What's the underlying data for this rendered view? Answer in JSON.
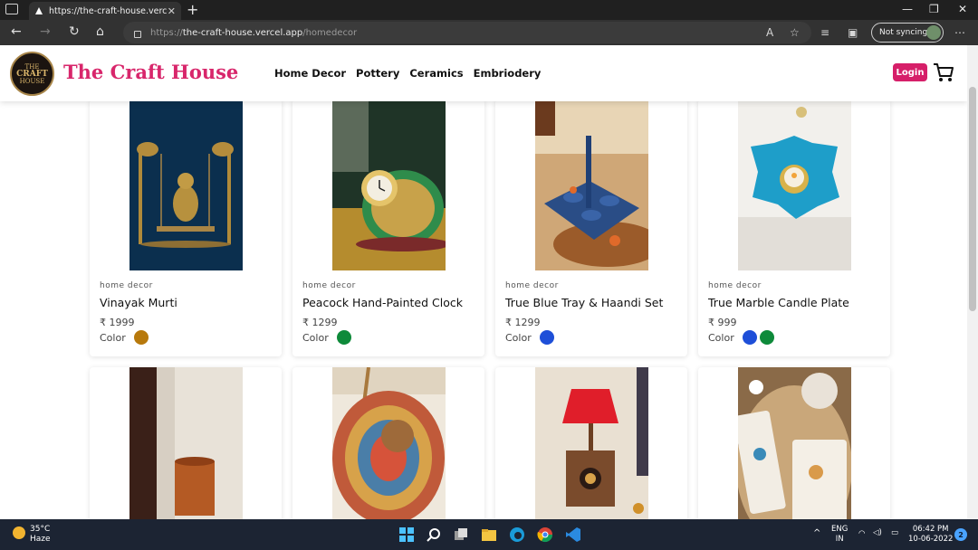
{
  "browser": {
    "tab_title": "https://the-craft-house.vercel.app",
    "url_prefix": "https://",
    "url_host": "the-craft-house.vercel.app",
    "url_path": "/homedecor",
    "sync_label": "Not syncing"
  },
  "site": {
    "logo_text": [
      "THE",
      "CRAFT",
      "HOUSE"
    ],
    "brand": "The Craft House",
    "nav": [
      "Home Decor",
      "Pottery",
      "Ceramics",
      "Embriodery"
    ],
    "login_label": "Login"
  },
  "products": [
    {
      "category": "home decor",
      "name": "Vinayak Murti",
      "price": "₹ 1999",
      "color_label": "Color",
      "colors": [
        "#b7790c"
      ]
    },
    {
      "category": "home decor",
      "name": "Peacock Hand-Painted Clock",
      "price": "₹ 1299",
      "color_label": "Color",
      "colors": [
        "#0e8a3a"
      ]
    },
    {
      "category": "home decor",
      "name": "True Blue Tray & Haandi Set",
      "price": "₹ 1299",
      "color_label": "Color",
      "colors": [
        "#1e4fd8"
      ]
    },
    {
      "category": "home decor",
      "name": "True Marble Candle Plate",
      "price": "₹ 999",
      "color_label": "Color",
      "colors": [
        "#1e4fd8",
        "#0e8a3a"
      ]
    }
  ],
  "taskbar": {
    "temp": "35°C",
    "weather": "Haze",
    "lang_top": "ENG",
    "lang_bottom": "IN",
    "time": "06:42 PM",
    "date": "10-06-2022",
    "notifications": "2"
  }
}
